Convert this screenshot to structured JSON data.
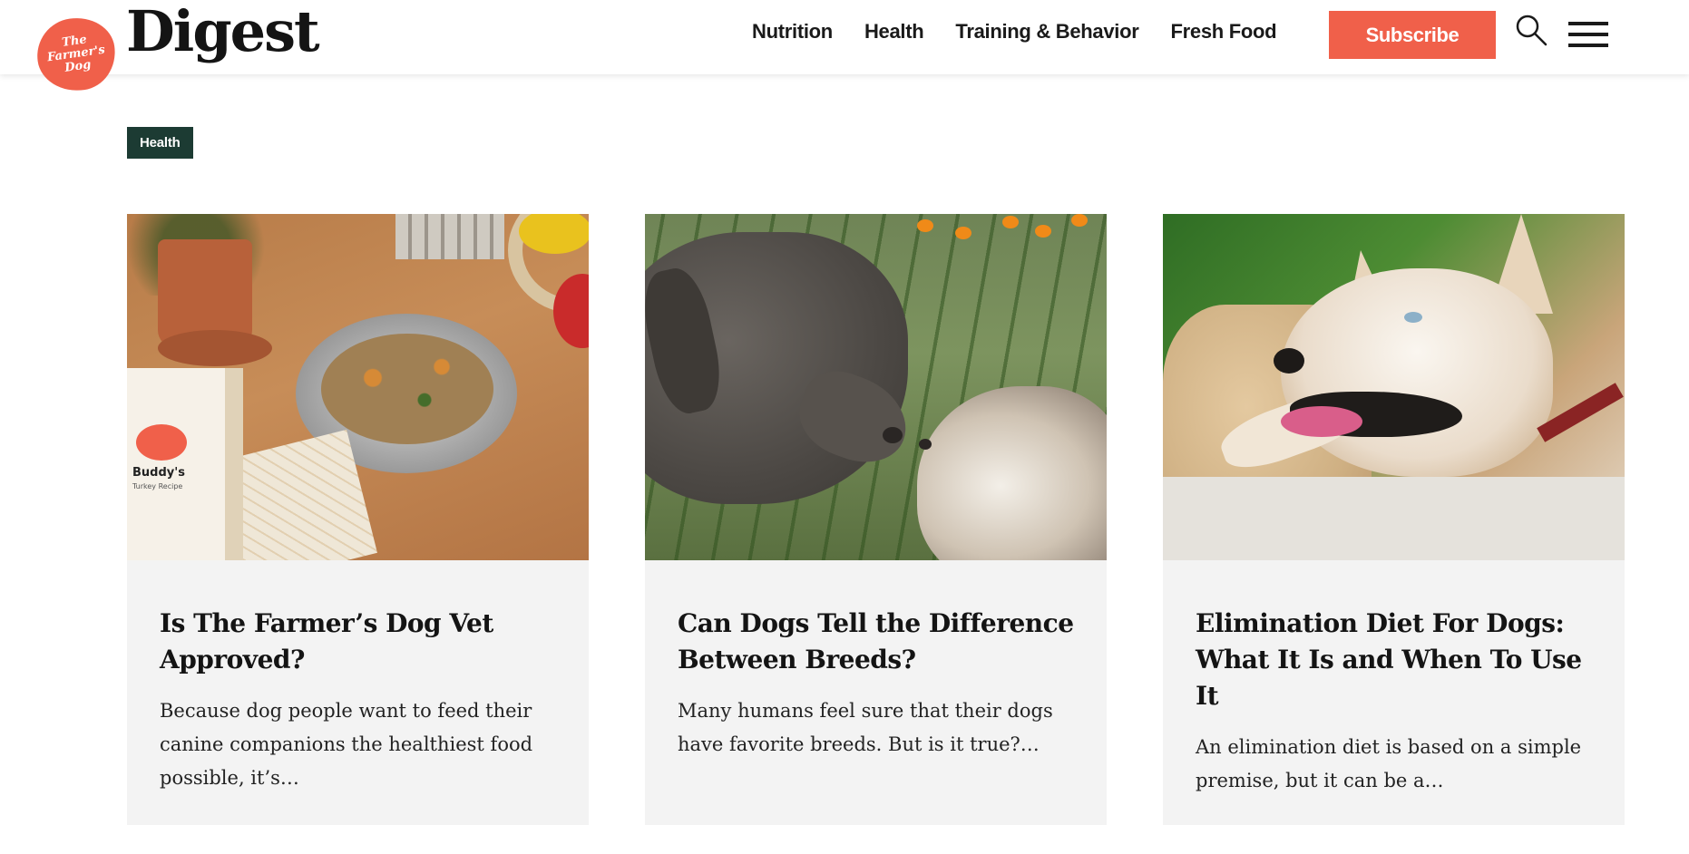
{
  "header": {
    "logo_text": "The\nFarmer's\nDog",
    "brand": "Digest",
    "nav": [
      "Nutrition",
      "Health",
      "Training & Behavior",
      "Fresh Food"
    ],
    "subscribe_label": "Subscribe",
    "icons": {
      "search": "search-icon",
      "menu": "hamburger-menu-icon"
    },
    "accent_color": "#f0604a"
  },
  "category": {
    "tag": "Health",
    "tag_color": "#1c3b33"
  },
  "cards": [
    {
      "title": "Is The Farmer’s Dog Vet Approved?",
      "excerpt": "Because dog people want to feed their canine companions the healthiest food possible, it’s…",
      "image_text": {
        "pack_name": "Buddy's",
        "pack_sub": "Turkey Recipe"
      }
    },
    {
      "title": "Can Dogs Tell the Difference Between Breeds?",
      "excerpt": "Many humans feel sure that their dogs have favorite breeds. But is it true?…"
    },
    {
      "title": "Elimination Diet For Dogs: What It Is and When To Use It",
      "excerpt": "An elimination diet is based on a simple premise, but it can be a…"
    }
  ]
}
